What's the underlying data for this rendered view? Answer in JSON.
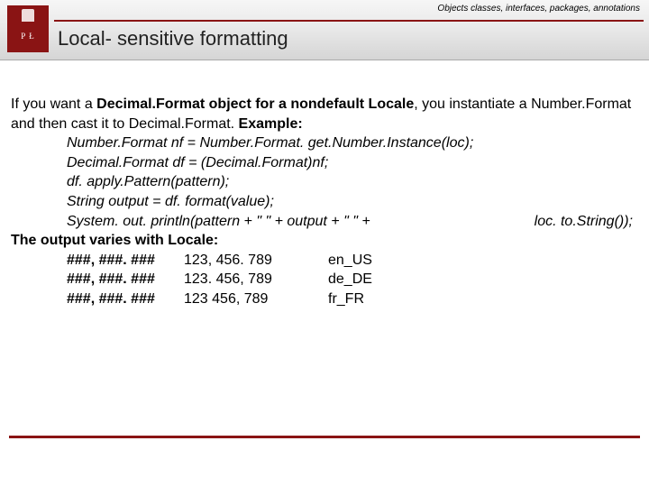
{
  "header": {
    "breadcrumb": "Objects classes, interfaces, packages, annotations",
    "title": "Local- sensitive formatting",
    "logo_text": "P Ł"
  },
  "body": {
    "intro_a": "If you want a ",
    "intro_b": "Decimal.Format object for a nondefault Locale",
    "intro_c": ", you instantiate a Number.Format and then cast it to Decimal.Format. ",
    "intro_d": "Example:",
    "code1": "Number.Format nf = Number.Format. get.Number.Instance(loc);",
    "code2": "Decimal.Format df = (Decimal.Format)nf;",
    "code3": "df. apply.Pattern(pattern);",
    "code4": "String output = df. format(value);",
    "code5_left": "System. out. println(pattern + \" \" + output + \" \" +",
    "code5_right": "loc. to.String());",
    "varies": "The output varies with Locale:",
    "table": [
      {
        "pattern": "###, ###. ###",
        "value": "123, 456. 789",
        "locale": "en_US"
      },
      {
        "pattern": "###, ###. ###",
        "value": "123. 456, 789",
        "locale": "de_DE"
      },
      {
        "pattern": "###, ###. ###",
        "value": "123 456, 789",
        "locale": "fr_FR"
      }
    ]
  }
}
